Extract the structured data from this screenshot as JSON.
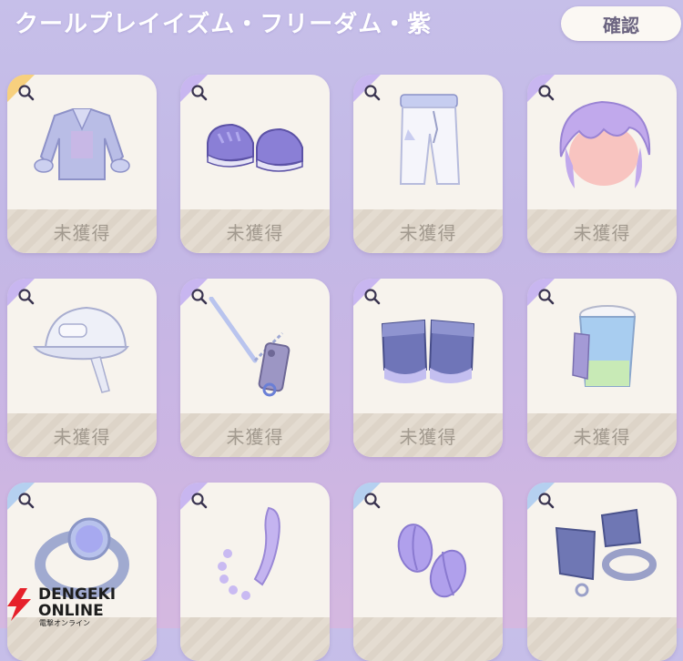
{
  "header": {
    "title": "クールプレイイズム・フリーダム・紫",
    "confirm_label": "確認"
  },
  "cards": [
    {
      "item": "jacket-item",
      "status": "未獲得",
      "corner": "gold"
    },
    {
      "item": "shoes-item",
      "status": "未獲得",
      "corner": "purple"
    },
    {
      "item": "pants-item",
      "status": "未獲得",
      "corner": "purple"
    },
    {
      "item": "hair-item",
      "status": "未獲得",
      "corner": "purple"
    },
    {
      "item": "cap-item",
      "status": "未獲得",
      "corner": "purple"
    },
    {
      "item": "phone-strap-item",
      "status": "未獲得",
      "corner": "purple"
    },
    {
      "item": "gloves-item",
      "status": "未獲得",
      "corner": "purple"
    },
    {
      "item": "cup-item",
      "status": "未獲得",
      "corner": "purple"
    },
    {
      "item": "ring-item",
      "status": "",
      "corner": "blue"
    },
    {
      "item": "earring-item",
      "status": "",
      "corner": "purple"
    },
    {
      "item": "beans-item",
      "status": "",
      "corner": "blue"
    },
    {
      "item": "bracelet-item",
      "status": "",
      "corner": "blue"
    }
  ],
  "watermark": {
    "line1": "DENGEKI",
    "line2": "ONLINE",
    "sub": "電撃オンライン"
  },
  "colors": {
    "card_bg": "#f7f3ed",
    "status_text": "#a29a8f",
    "accent_purple": "#b8a4e6"
  }
}
